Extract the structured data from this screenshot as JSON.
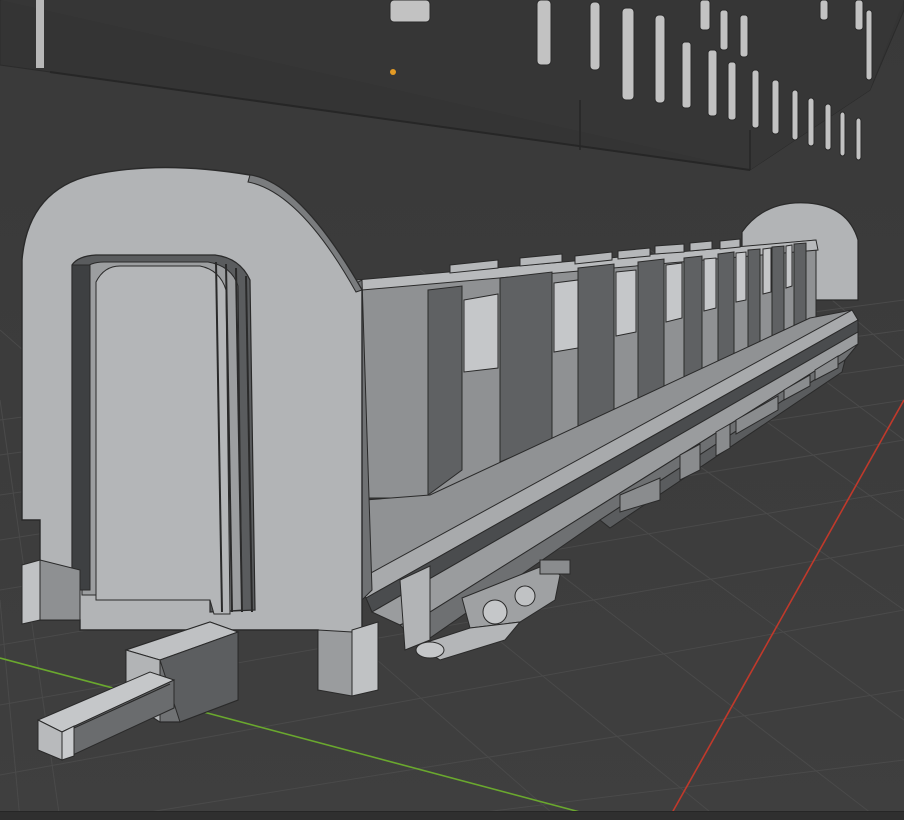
{
  "app": {
    "name": "3D Viewport",
    "theme": {
      "background": "#3b3b3b",
      "grid_line": "#474747",
      "grid_line_major": "#4f4f4f",
      "x_axis": "#c0392b",
      "y_axis": "#6aa82e",
      "object_origin": "#e39a24",
      "mesh_light": "#b5b7b9",
      "mesh_mid": "#8e9092",
      "mesh_dark": "#555759",
      "mesh_edge": "#2a2a2a"
    }
  },
  "viewport": {
    "object_names": [
      "railway-coach-body",
      "coach-side-panel-plane",
      "coupler",
      "bogie"
    ],
    "window_count_side": 8
  }
}
